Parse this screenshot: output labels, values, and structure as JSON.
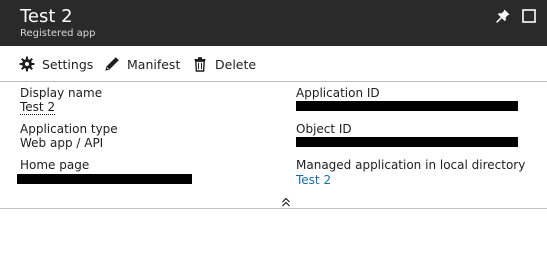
{
  "header": {
    "title": "Test 2",
    "subtitle": "Registered app"
  },
  "toolbar": {
    "settings_label": "Settings",
    "manifest_label": "Manifest",
    "delete_label": "Delete"
  },
  "essentials": {
    "display_name": {
      "label": "Display name",
      "value": "Test 2"
    },
    "application_type": {
      "label": "Application type",
      "value": "Web app / API"
    },
    "home_page": {
      "label": "Home page"
    },
    "application_id": {
      "label": "Application ID"
    },
    "object_id": {
      "label": "Object ID"
    },
    "managed_app": {
      "label": "Managed application in local directory",
      "value": "Test 2"
    }
  },
  "colors": {
    "header_bg": "#2a2a2a",
    "link": "#1a6ea8"
  },
  "icons": [
    "pin-icon",
    "maximize-icon",
    "gear-icon",
    "pencil-icon",
    "trash-icon",
    "chevron-up-double-icon"
  ]
}
